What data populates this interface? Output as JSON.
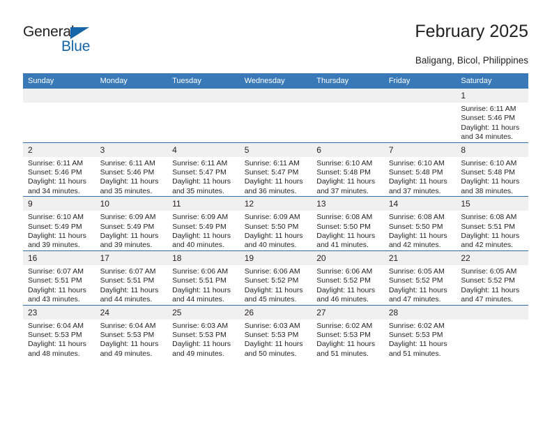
{
  "brand": {
    "word_one": "General",
    "word_two": "Blue",
    "triangle_icon": "triangle-icon",
    "accent_color": "#1565a8"
  },
  "header": {
    "title": "February 2025",
    "subtitle": "Baligang, Bicol, Philippines"
  },
  "colors": {
    "header_blue": "#3a79b8",
    "row_rule_blue": "#2f6da9",
    "daynum_band": "#f0f0f0",
    "text": "#231f20"
  },
  "weekdays": [
    "Sunday",
    "Monday",
    "Tuesday",
    "Wednesday",
    "Thursday",
    "Friday",
    "Saturday"
  ],
  "labels": {
    "sunrise": "Sunrise:",
    "sunset": "Sunset:",
    "daylight": "Daylight:"
  },
  "weeks": [
    [
      {
        "day": "",
        "sunrise": "",
        "sunset": "",
        "daylight": ""
      },
      {
        "day": "",
        "sunrise": "",
        "sunset": "",
        "daylight": ""
      },
      {
        "day": "",
        "sunrise": "",
        "sunset": "",
        "daylight": ""
      },
      {
        "day": "",
        "sunrise": "",
        "sunset": "",
        "daylight": ""
      },
      {
        "day": "",
        "sunrise": "",
        "sunset": "",
        "daylight": ""
      },
      {
        "day": "",
        "sunrise": "",
        "sunset": "",
        "daylight": ""
      },
      {
        "day": "1",
        "sunrise": "Sunrise: 6:11 AM",
        "sunset": "Sunset: 5:46 PM",
        "daylight": "Daylight: 11 hours and 34 minutes."
      }
    ],
    [
      {
        "day": "2",
        "sunrise": "Sunrise: 6:11 AM",
        "sunset": "Sunset: 5:46 PM",
        "daylight": "Daylight: 11 hours and 34 minutes."
      },
      {
        "day": "3",
        "sunrise": "Sunrise: 6:11 AM",
        "sunset": "Sunset: 5:46 PM",
        "daylight": "Daylight: 11 hours and 35 minutes."
      },
      {
        "day": "4",
        "sunrise": "Sunrise: 6:11 AM",
        "sunset": "Sunset: 5:47 PM",
        "daylight": "Daylight: 11 hours and 35 minutes."
      },
      {
        "day": "5",
        "sunrise": "Sunrise: 6:11 AM",
        "sunset": "Sunset: 5:47 PM",
        "daylight": "Daylight: 11 hours and 36 minutes."
      },
      {
        "day": "6",
        "sunrise": "Sunrise: 6:10 AM",
        "sunset": "Sunset: 5:48 PM",
        "daylight": "Daylight: 11 hours and 37 minutes."
      },
      {
        "day": "7",
        "sunrise": "Sunrise: 6:10 AM",
        "sunset": "Sunset: 5:48 PM",
        "daylight": "Daylight: 11 hours and 37 minutes."
      },
      {
        "day": "8",
        "sunrise": "Sunrise: 6:10 AM",
        "sunset": "Sunset: 5:48 PM",
        "daylight": "Daylight: 11 hours and 38 minutes."
      }
    ],
    [
      {
        "day": "9",
        "sunrise": "Sunrise: 6:10 AM",
        "sunset": "Sunset: 5:49 PM",
        "daylight": "Daylight: 11 hours and 39 minutes."
      },
      {
        "day": "10",
        "sunrise": "Sunrise: 6:09 AM",
        "sunset": "Sunset: 5:49 PM",
        "daylight": "Daylight: 11 hours and 39 minutes."
      },
      {
        "day": "11",
        "sunrise": "Sunrise: 6:09 AM",
        "sunset": "Sunset: 5:49 PM",
        "daylight": "Daylight: 11 hours and 40 minutes."
      },
      {
        "day": "12",
        "sunrise": "Sunrise: 6:09 AM",
        "sunset": "Sunset: 5:50 PM",
        "daylight": "Daylight: 11 hours and 40 minutes."
      },
      {
        "day": "13",
        "sunrise": "Sunrise: 6:08 AM",
        "sunset": "Sunset: 5:50 PM",
        "daylight": "Daylight: 11 hours and 41 minutes."
      },
      {
        "day": "14",
        "sunrise": "Sunrise: 6:08 AM",
        "sunset": "Sunset: 5:50 PM",
        "daylight": "Daylight: 11 hours and 42 minutes."
      },
      {
        "day": "15",
        "sunrise": "Sunrise: 6:08 AM",
        "sunset": "Sunset: 5:51 PM",
        "daylight": "Daylight: 11 hours and 42 minutes."
      }
    ],
    [
      {
        "day": "16",
        "sunrise": "Sunrise: 6:07 AM",
        "sunset": "Sunset: 5:51 PM",
        "daylight": "Daylight: 11 hours and 43 minutes."
      },
      {
        "day": "17",
        "sunrise": "Sunrise: 6:07 AM",
        "sunset": "Sunset: 5:51 PM",
        "daylight": "Daylight: 11 hours and 44 minutes."
      },
      {
        "day": "18",
        "sunrise": "Sunrise: 6:06 AM",
        "sunset": "Sunset: 5:51 PM",
        "daylight": "Daylight: 11 hours and 44 minutes."
      },
      {
        "day": "19",
        "sunrise": "Sunrise: 6:06 AM",
        "sunset": "Sunset: 5:52 PM",
        "daylight": "Daylight: 11 hours and 45 minutes."
      },
      {
        "day": "20",
        "sunrise": "Sunrise: 6:06 AM",
        "sunset": "Sunset: 5:52 PM",
        "daylight": "Daylight: 11 hours and 46 minutes."
      },
      {
        "day": "21",
        "sunrise": "Sunrise: 6:05 AM",
        "sunset": "Sunset: 5:52 PM",
        "daylight": "Daylight: 11 hours and 47 minutes."
      },
      {
        "day": "22",
        "sunrise": "Sunrise: 6:05 AM",
        "sunset": "Sunset: 5:52 PM",
        "daylight": "Daylight: 11 hours and 47 minutes."
      }
    ],
    [
      {
        "day": "23",
        "sunrise": "Sunrise: 6:04 AM",
        "sunset": "Sunset: 5:53 PM",
        "daylight": "Daylight: 11 hours and 48 minutes."
      },
      {
        "day": "24",
        "sunrise": "Sunrise: 6:04 AM",
        "sunset": "Sunset: 5:53 PM",
        "daylight": "Daylight: 11 hours and 49 minutes."
      },
      {
        "day": "25",
        "sunrise": "Sunrise: 6:03 AM",
        "sunset": "Sunset: 5:53 PM",
        "daylight": "Daylight: 11 hours and 49 minutes."
      },
      {
        "day": "26",
        "sunrise": "Sunrise: 6:03 AM",
        "sunset": "Sunset: 5:53 PM",
        "daylight": "Daylight: 11 hours and 50 minutes."
      },
      {
        "day": "27",
        "sunrise": "Sunrise: 6:02 AM",
        "sunset": "Sunset: 5:53 PM",
        "daylight": "Daylight: 11 hours and 51 minutes."
      },
      {
        "day": "28",
        "sunrise": "Sunrise: 6:02 AM",
        "sunset": "Sunset: 5:53 PM",
        "daylight": "Daylight: 11 hours and 51 minutes."
      },
      {
        "day": "",
        "sunrise": "",
        "sunset": "",
        "daylight": ""
      }
    ]
  ]
}
